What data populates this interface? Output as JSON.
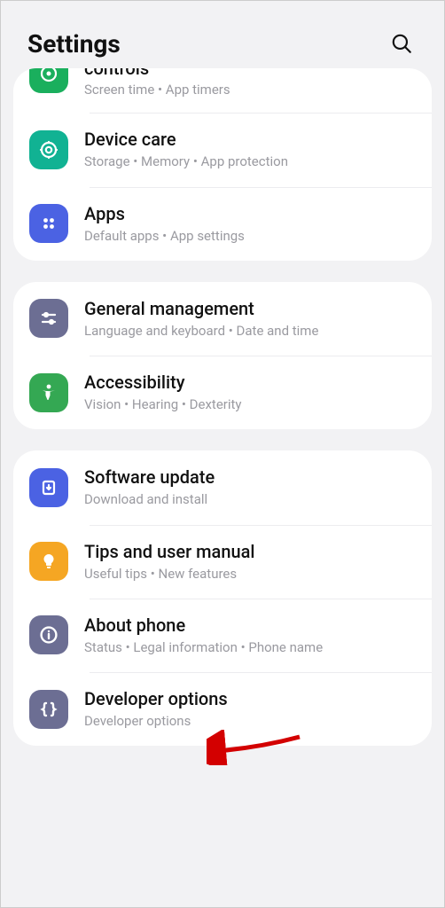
{
  "header": {
    "title": "Settings"
  },
  "groups": [
    {
      "items": [
        {
          "id": "digital",
          "title": "controls",
          "subtitle": "Screen time  •  App timers",
          "icon": "digital-wellbeing-icon",
          "color": "#1aaf5d",
          "partial": true
        },
        {
          "id": "devicecare",
          "title": "Device care",
          "subtitle": "Storage  •  Memory  •  App protection",
          "icon": "device-care-icon",
          "color": "#11b293"
        },
        {
          "id": "apps",
          "title": "Apps",
          "subtitle": "Default apps  •  App settings",
          "icon": "apps-icon",
          "color": "#4b62e3"
        }
      ]
    },
    {
      "items": [
        {
          "id": "general",
          "title": "General management",
          "subtitle": "Language and keyboard  •  Date and time",
          "icon": "sliders-icon",
          "color": "#6c6e93"
        },
        {
          "id": "accessibility",
          "title": "Accessibility",
          "subtitle": "Vision  •  Hearing  •  Dexterity",
          "icon": "accessibility-icon",
          "color": "#34a853"
        }
      ]
    },
    {
      "items": [
        {
          "id": "software",
          "title": "Software update",
          "subtitle": "Download and install",
          "icon": "update-icon",
          "color": "#4b62e3"
        },
        {
          "id": "tips",
          "title": "Tips and user manual",
          "subtitle": "Useful tips  •  New features",
          "icon": "lightbulb-icon",
          "color": "#f5a623"
        },
        {
          "id": "about",
          "title": "About phone",
          "subtitle": "Status  •  Legal information  •  Phone name",
          "icon": "info-icon",
          "color": "#6c6e93"
        },
        {
          "id": "developer",
          "title": "Developer options",
          "subtitle": "Developer options",
          "icon": "braces-icon",
          "color": "#6c6e93"
        }
      ]
    }
  ],
  "annotation": {
    "target": "about"
  }
}
